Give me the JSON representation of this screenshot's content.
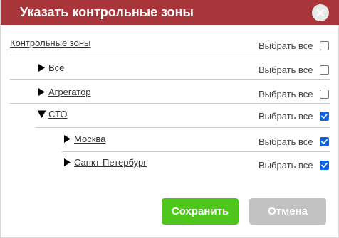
{
  "dialog": {
    "title": "Указать контрольные зоны",
    "header_color": "#a8353a",
    "close_icon": "close-icon"
  },
  "tree": [
    {
      "label": "Контрольные зоны",
      "level": 0,
      "arrow": "none",
      "select_all": "Выбрать все",
      "checked": false
    },
    {
      "label": "Все",
      "level": 1,
      "arrow": "right",
      "select_all": "Выбрать все",
      "checked": false
    },
    {
      "label": "Агрегатор",
      "level": 1,
      "arrow": "right",
      "select_all": "Выбрать все",
      "checked": false
    },
    {
      "label": "СТО",
      "level": 1,
      "arrow": "down",
      "select_all": "Выбрать все",
      "checked": true
    },
    {
      "label": "Москва",
      "level": 2,
      "arrow": "right",
      "select_all": "Выбрать все",
      "checked": true
    },
    {
      "label": "Санкт-Петербург",
      "level": 2,
      "arrow": "right",
      "select_all": "Выбрать все",
      "checked": true
    }
  ],
  "buttons": {
    "save_label": "Сохранить",
    "cancel_label": "Отмена",
    "save_color": "#4fc61c",
    "cancel_color": "#c2c2c2"
  }
}
